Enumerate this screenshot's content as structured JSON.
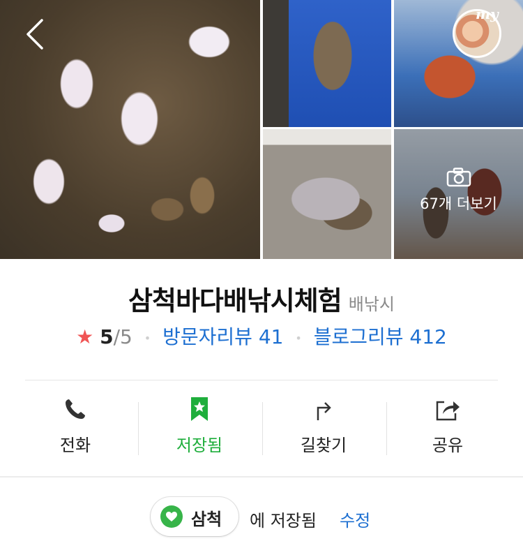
{
  "gallery": {
    "more_photos_label": "67개 더보기",
    "my_label": "my"
  },
  "place": {
    "name": "삼척바다배낚시체험",
    "category": "배낚시"
  },
  "rating": {
    "score": "5",
    "max": "/5",
    "visitor_reviews_label": "방문자리뷰 41",
    "blog_reviews_label": "블로그리뷰 412",
    "star_color": "#f05454"
  },
  "actions": [
    {
      "label": "전화",
      "icon": "phone-icon"
    },
    {
      "label": "저장됨",
      "icon": "bookmark-star-icon",
      "active": true,
      "color": "#1fae3c"
    },
    {
      "label": "길찾기",
      "icon": "directions-arrow-icon"
    },
    {
      "label": "공유",
      "icon": "share-icon"
    }
  ],
  "saved": {
    "folder_label": "삼척",
    "saved_text": "에 저장됨",
    "edit_label": "수정",
    "folder_color": "#37b449"
  }
}
